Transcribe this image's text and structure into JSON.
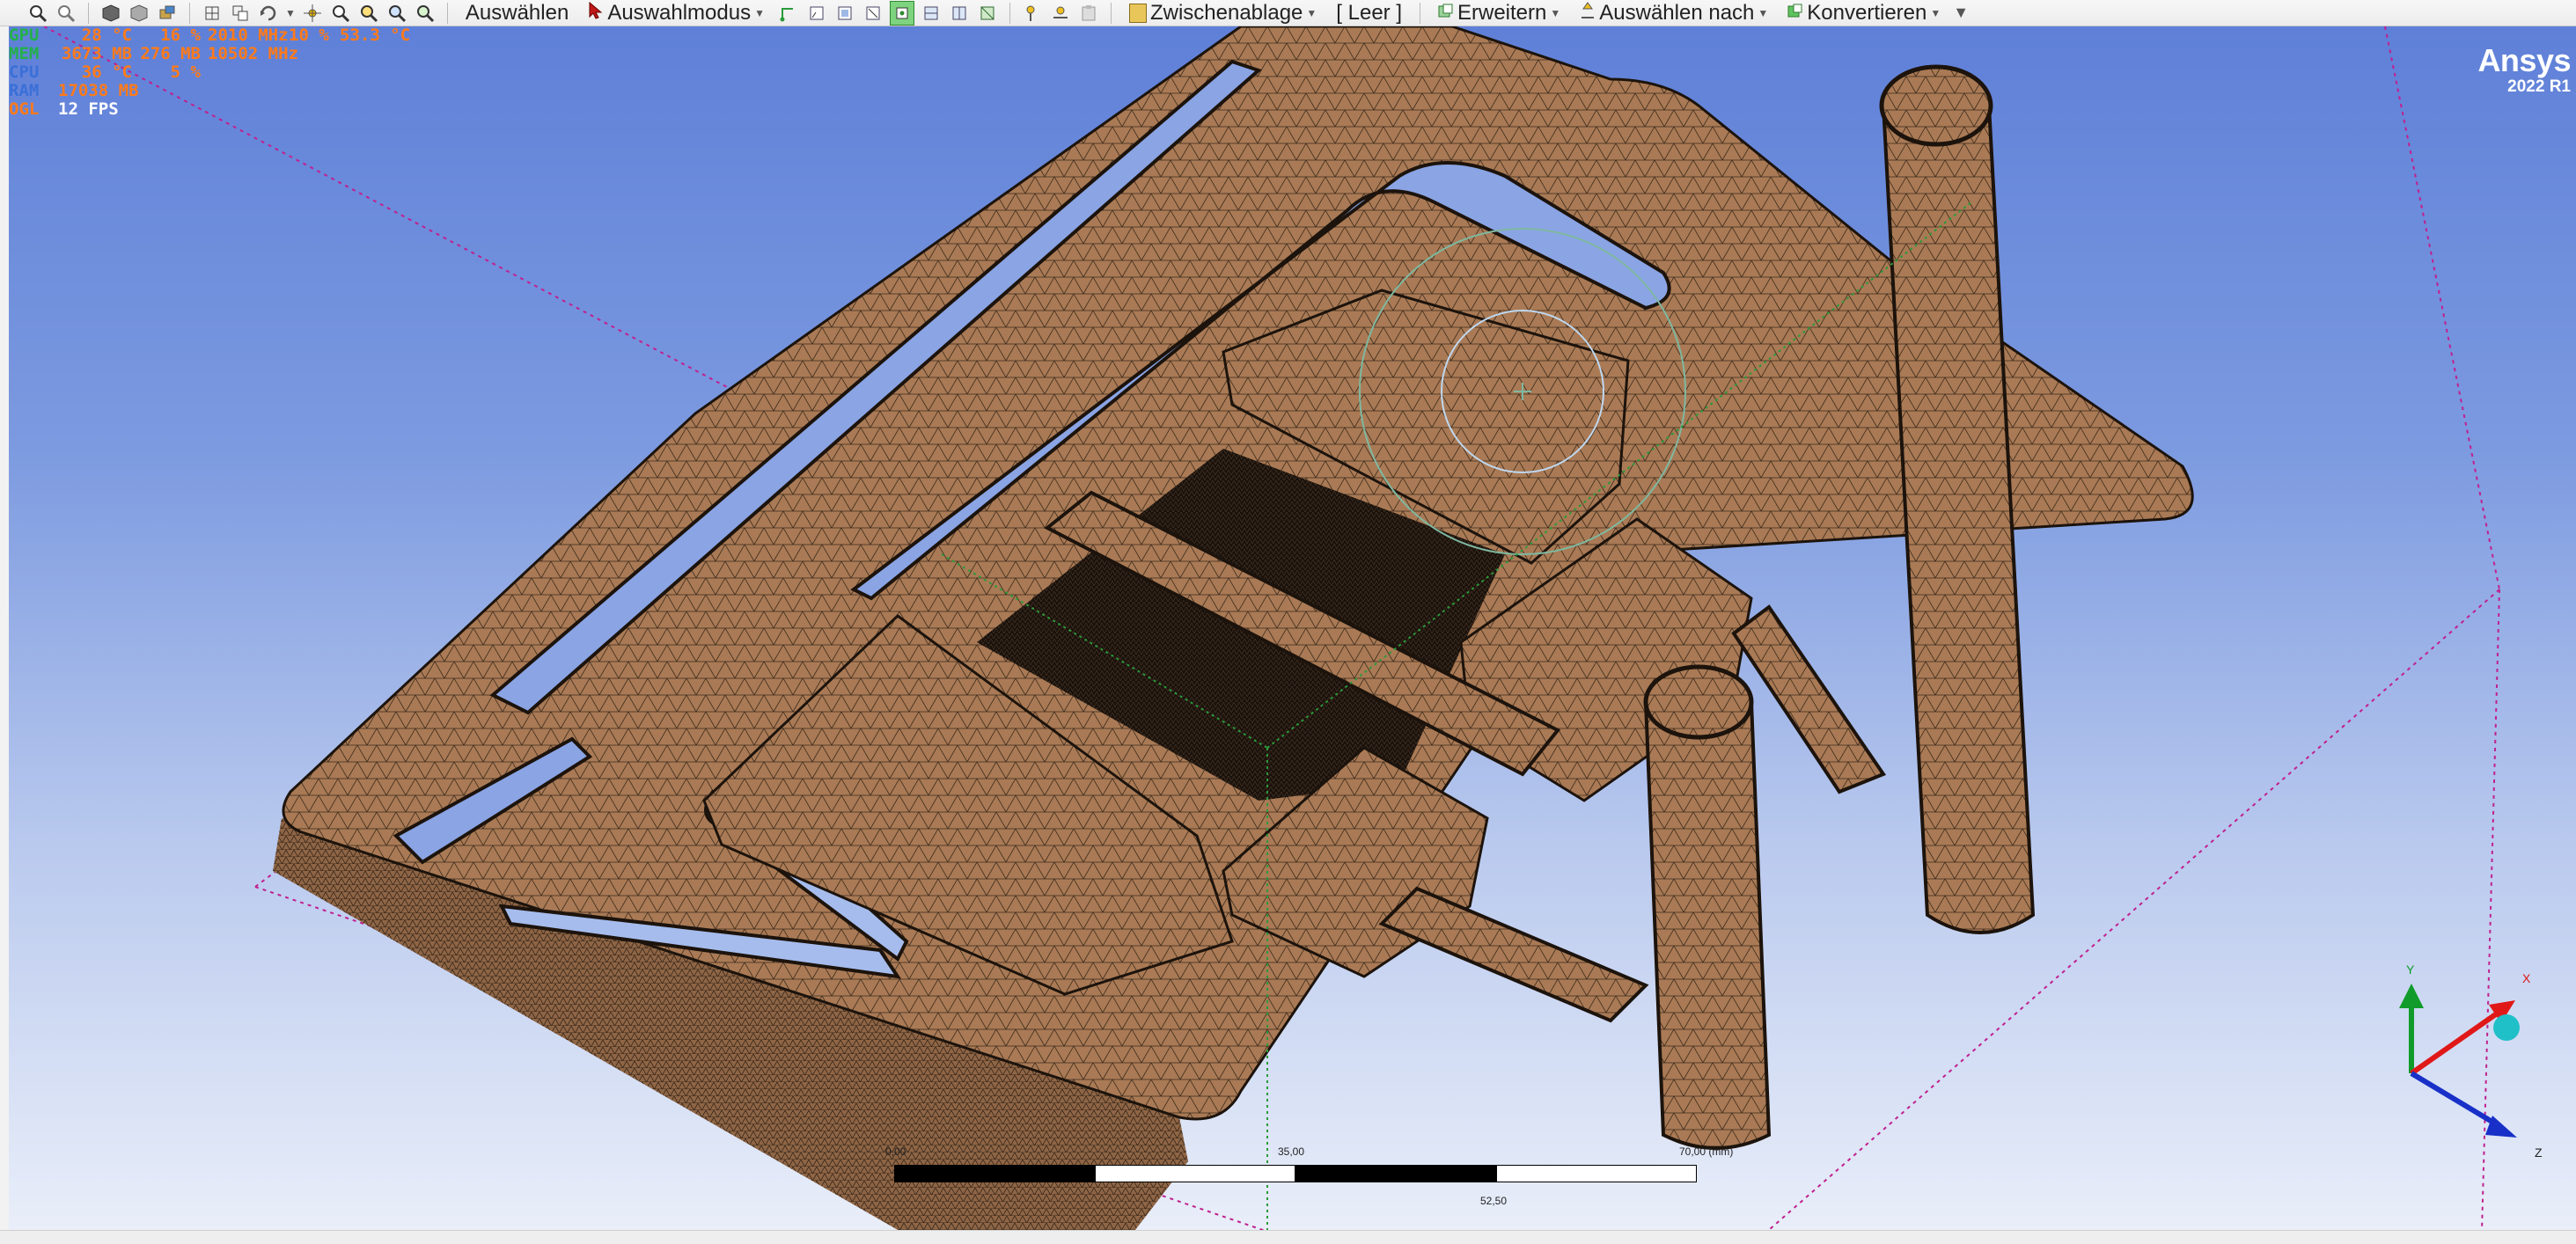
{
  "toolbar": {
    "select_label": "Auswählen",
    "select_mode_label": "Auswahlmodus",
    "clipboard_label": "Zwischenablage",
    "clipboard_value": "[ Leer ]",
    "extend_label": "Erweitern",
    "select_by_label": "Auswählen nach",
    "convert_label": "Konvertieren"
  },
  "overlay": {
    "rows": [
      {
        "label": "GPU",
        "v1": "28 °C",
        "v2": "16 %",
        "v3": "2010 MHz",
        "v4": "10 %",
        "v5": "53.3 °C"
      },
      {
        "label": "MEM",
        "v1": "3673 MB",
        "v2": "276 MB",
        "v3": "10502 MHz"
      },
      {
        "label": "CPU",
        "v1": "36 °C",
        "v2": "5 %"
      },
      {
        "label": "RAM",
        "v1": "17038 MB"
      },
      {
        "label": "OGL",
        "v1": "12 FPS"
      }
    ]
  },
  "brand": {
    "name": "Ansys",
    "version": "2022 R1"
  },
  "scale_bar": {
    "start": "0,00",
    "mid": "35,00",
    "end": "70,00 (mm)",
    "sub": "52,50"
  },
  "triad": {
    "x": "X",
    "y": "Y",
    "z": "Z"
  },
  "colors": {
    "mesh_fill": "#a97a55",
    "mesh_dark": "#6a4a30",
    "triad_x": "#e01818",
    "triad_y": "#109b2a",
    "triad_z": "#1830c8"
  }
}
